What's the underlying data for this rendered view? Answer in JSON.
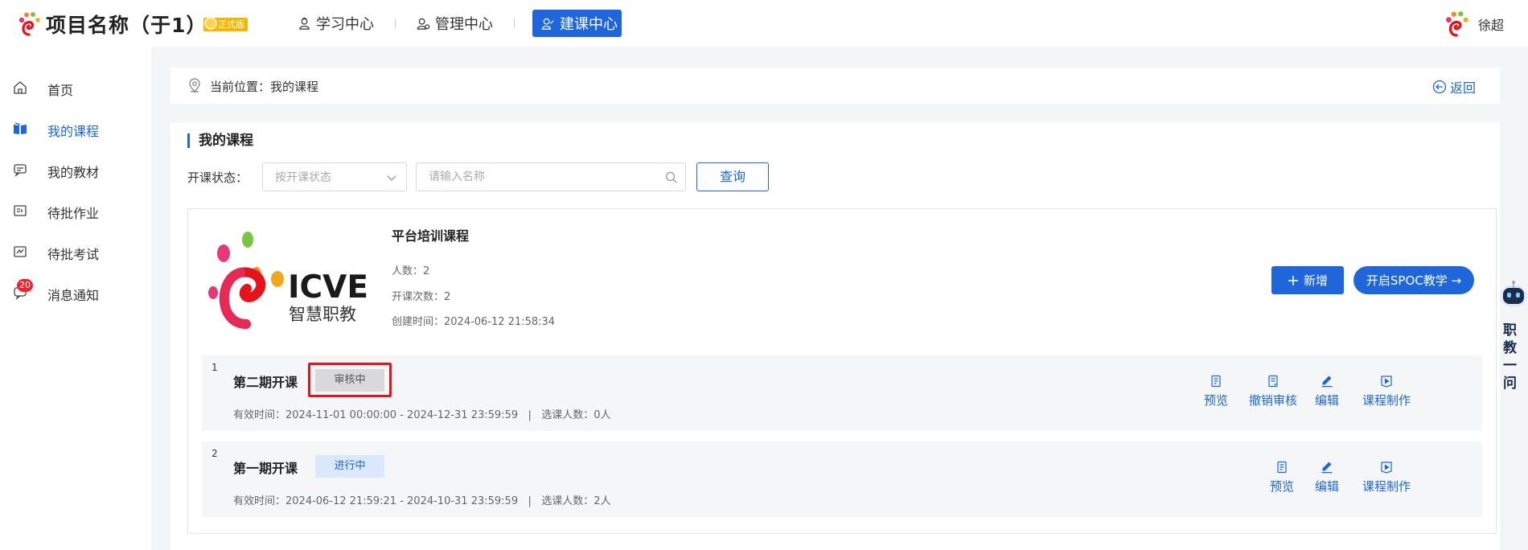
{
  "header": {
    "project_title": "项目名称（于1）",
    "edition_badge": "正式版",
    "nav": [
      {
        "label": "学习中心",
        "icon": "study-center-icon",
        "active": false
      },
      {
        "label": "管理中心",
        "icon": "manage-center-icon",
        "active": false
      },
      {
        "label": "建课中心",
        "icon": "course-build-icon",
        "active": true
      }
    ],
    "user_name": "徐超"
  },
  "sidebar": {
    "items": [
      {
        "label": "首页",
        "icon": "home-icon"
      },
      {
        "label": "我的课程",
        "icon": "book-icon",
        "active": true
      },
      {
        "label": "我的教材",
        "icon": "textbook-icon"
      },
      {
        "label": "待批作业",
        "icon": "homework-icon"
      },
      {
        "label": "待批考试",
        "icon": "exam-icon"
      },
      {
        "label": "消息通知",
        "icon": "message-icon",
        "badge": "20"
      }
    ]
  },
  "breadcrumb": {
    "location": "当前位置：我的课程",
    "back_label": "返回"
  },
  "main": {
    "section_title": "我的课程",
    "filter": {
      "label": "开课状态：",
      "status_placeholder": "按开课状态",
      "name_placeholder": "请输入名称",
      "query_label": "查询"
    },
    "course": {
      "name": "平台培训课程",
      "people": "人数：2",
      "sessions_count": "开课次数：2",
      "created": "创建时间：2024-06-12 21:58:34",
      "cover_text": "ICVE",
      "cover_subtext": "智慧职教",
      "add_label": "新增",
      "spoc_label": "开启SPOC教学 →",
      "sessions": [
        {
          "index": "1",
          "name": "第二期开课",
          "status": "审核中",
          "meta": "有效时间：2024-11-01 00:00:00 - 2024-12-31 23:59:59   |   选课人数：0人",
          "ops": [
            "预览",
            "撤销审核",
            "编辑",
            "课程制作"
          ]
        },
        {
          "index": "2",
          "name": "第一期开课",
          "status": "进行中",
          "meta": "有效时间：2024-06-12 21:59:21 - 2024-10-31 23:59:59   |   选课人数：2人",
          "ops": [
            "预览",
            "编辑",
            "课程制作"
          ]
        }
      ]
    }
  },
  "assistant": {
    "label": "职教一问"
  },
  "colors": {
    "primary": "#1e66d9",
    "highlight": "#e5141c",
    "badge": "#f5222d",
    "edition": "#f7b500"
  }
}
